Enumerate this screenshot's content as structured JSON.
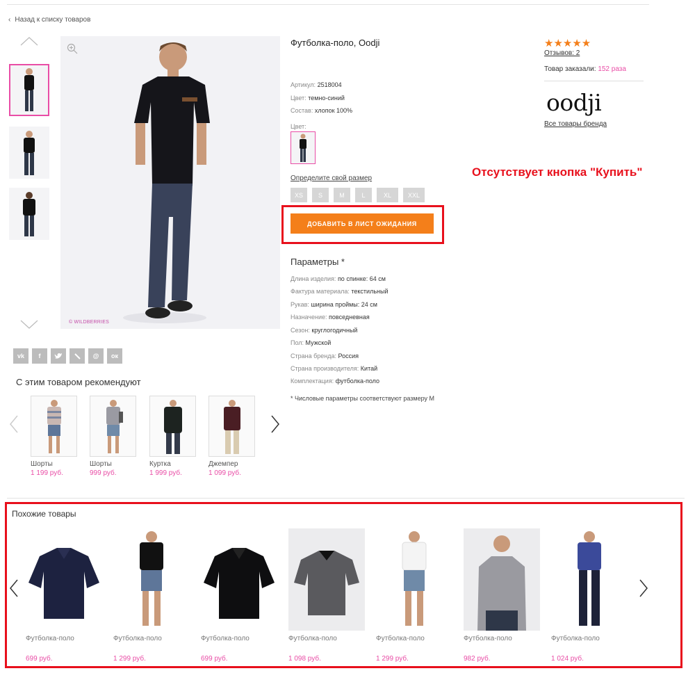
{
  "nav": {
    "back_label": "Назад к списку товаров"
  },
  "product": {
    "title": "Футболка-поло, Oodji",
    "watermark": "© WILDBERRIES",
    "props": [
      {
        "label": "Артикул:",
        "value": "2518004"
      },
      {
        "label": "Цвет:",
        "value": "темно-синий"
      },
      {
        "label": "Состав:",
        "value": "хлопок 100%"
      }
    ],
    "color_label": "Цвет:",
    "size_link": "Определите свой размер",
    "sizes": [
      "XS",
      "S",
      "M",
      "L",
      "XL",
      "XXL"
    ],
    "waitlist_button": "ДОБАВИТЬ В ЛИСТ ОЖИДАНИЯ",
    "params_title": "Параметры *",
    "params": [
      {
        "label": "Длина изделия:",
        "value": "по спинке: 64 см"
      },
      {
        "label": "Фактура материала:",
        "value": "текстильный"
      },
      {
        "label": "Рукав:",
        "value": "ширина проймы: 24 см"
      },
      {
        "label": "Назначение:",
        "value": "повседневная"
      },
      {
        "label": "Сезон:",
        "value": "круглогодичный"
      },
      {
        "label": "Пол:",
        "value": "Мужской"
      },
      {
        "label": "Страна бренда:",
        "value": "Россия"
      },
      {
        "label": "Страна производителя:",
        "value": "Китай"
      },
      {
        "label": "Комплектация:",
        "value": "футболка-поло"
      }
    ],
    "footnote": "* Числовые параметры соответствуют размеру M"
  },
  "sidebar": {
    "stars": "★★★★★",
    "reviews": "Отзывов: 2",
    "ordered_label": "Товар заказали:",
    "ordered_value": "152 раза",
    "brand_logo": "oodji",
    "brand_link": "Все товары бренда"
  },
  "annotation": {
    "missing_buy": "Отсутствует кнопка \"Купить\""
  },
  "social": [
    "vk-icon",
    "facebook-icon",
    "twitter-icon",
    "livejournal-icon",
    "mail-icon",
    "odnoklassniki-icon"
  ],
  "recommend": {
    "title": "С этим товаром рекомендуют",
    "items": [
      {
        "name": "Шорты",
        "price": "1 199 руб."
      },
      {
        "name": "Шорты",
        "price": "999 руб."
      },
      {
        "name": "Куртка",
        "price": "1 999 руб."
      },
      {
        "name": "Джемпер",
        "price": "1 099 руб."
      }
    ]
  },
  "similar": {
    "title": "Похожие товары",
    "items": [
      {
        "name": "Футболка-поло",
        "price": "699 руб."
      },
      {
        "name": "Футболка-поло",
        "price": "1 299 руб."
      },
      {
        "name": "Футболка-поло",
        "price": "699 руб."
      },
      {
        "name": "Футболка-поло",
        "price": "1 098 руб."
      },
      {
        "name": "Футболка-поло",
        "price": "1 299 руб."
      },
      {
        "name": "Футболка-поло",
        "price": "982 руб."
      },
      {
        "name": "Футболка-поло",
        "price": "1 024 руб."
      }
    ]
  },
  "colors": {
    "accent_orange": "#f47f1a",
    "pink": "#e94da6",
    "annotation_red": "#e8101c"
  }
}
